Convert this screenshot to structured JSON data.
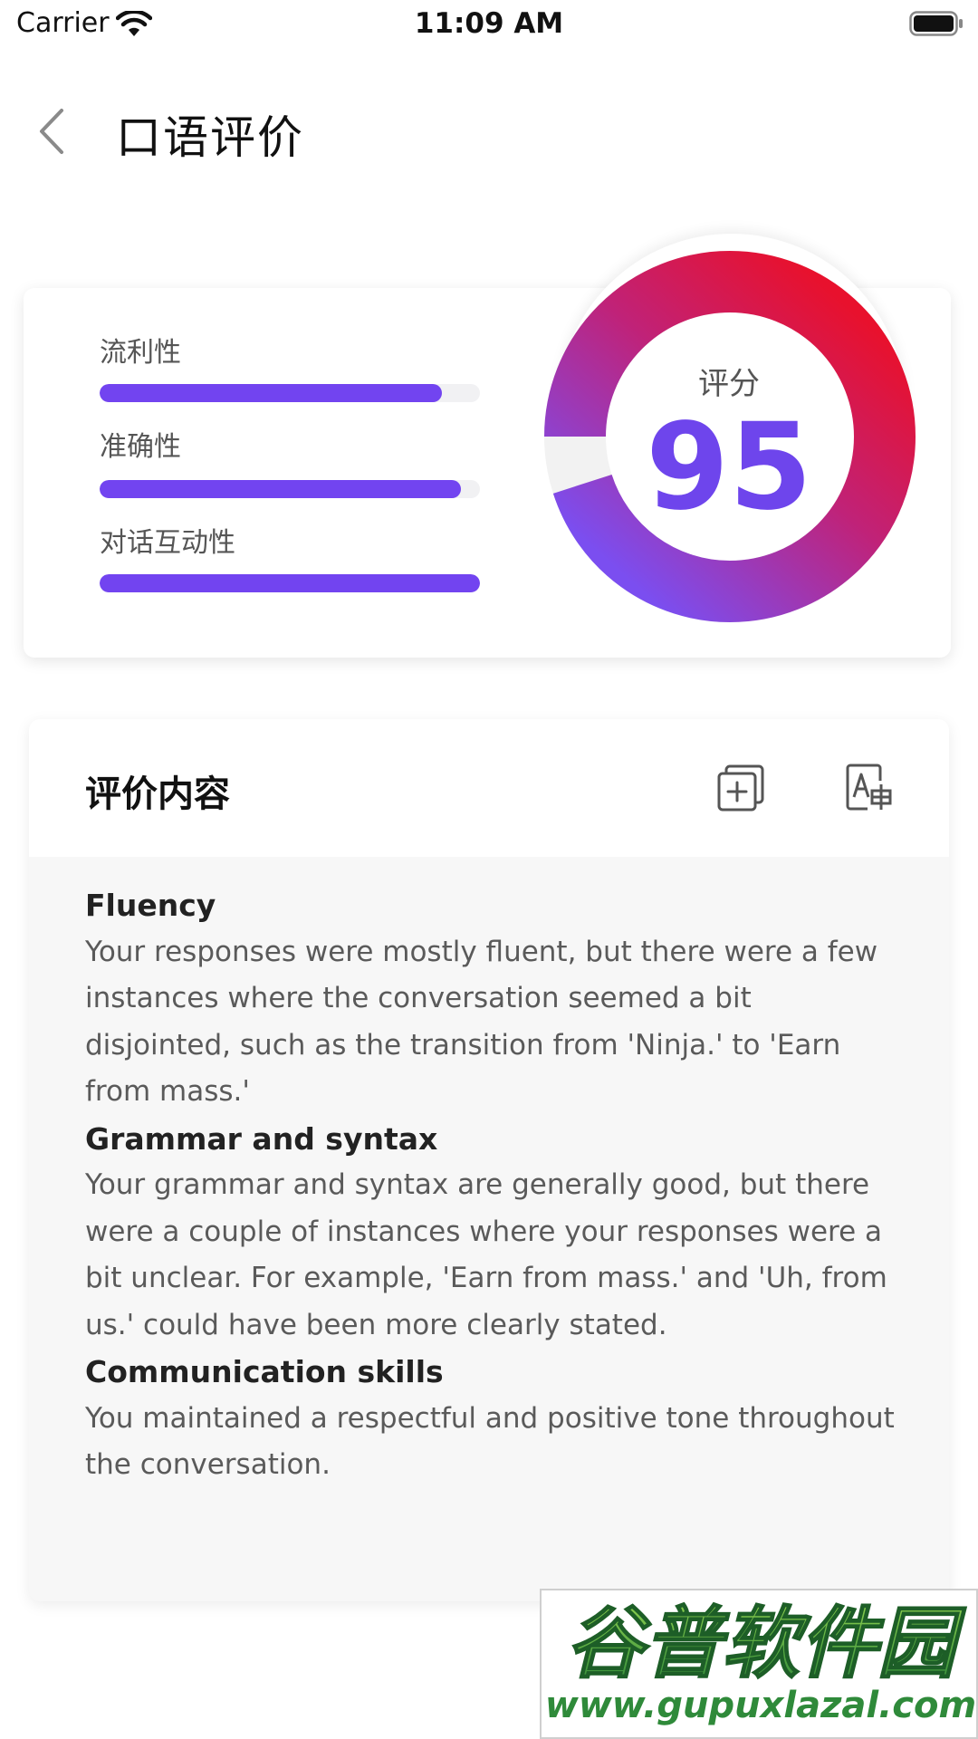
{
  "status_bar": {
    "carrier": "Carrier",
    "time": "11:09 AM"
  },
  "header": {
    "title": "口语评价"
  },
  "score_card": {
    "metrics": [
      {
        "label": "流利性",
        "progress": 0.9
      },
      {
        "label": "准确性",
        "progress": 0.95
      },
      {
        "label": "对话互动性",
        "progress": 1.0
      }
    ],
    "score_caption": "评分",
    "score_value": "95",
    "ring_progress": 0.95,
    "colors": {
      "accent": "#6e45ec",
      "ring_start": "#e8112d",
      "ring_end": "#7b4ef0"
    }
  },
  "evaluation": {
    "title": "评价内容",
    "copy_icon": "copy-add-icon",
    "translate_icon": "translate-icon",
    "sections": [
      {
        "heading": "Fluency",
        "text": "Your responses were mostly fluent, but there were a few instances where the conversation seemed a bit disjointed, such as the transition from 'Ninja.' to 'Earn from mass.'"
      },
      {
        "heading": "Grammar and syntax",
        "text": "Your grammar and syntax are generally good, but there were a couple of instances where your responses were a bit unclear. For example, 'Earn from mass.' and 'Uh, from us.' could have been more clearly stated."
      },
      {
        "heading": "Communication skills",
        "text": "You maintained a respectful and positive tone throughout the conversation."
      }
    ]
  },
  "watermark": {
    "logo_text": "谷普软件园",
    "url": "www.gupuxlazal.com"
  }
}
